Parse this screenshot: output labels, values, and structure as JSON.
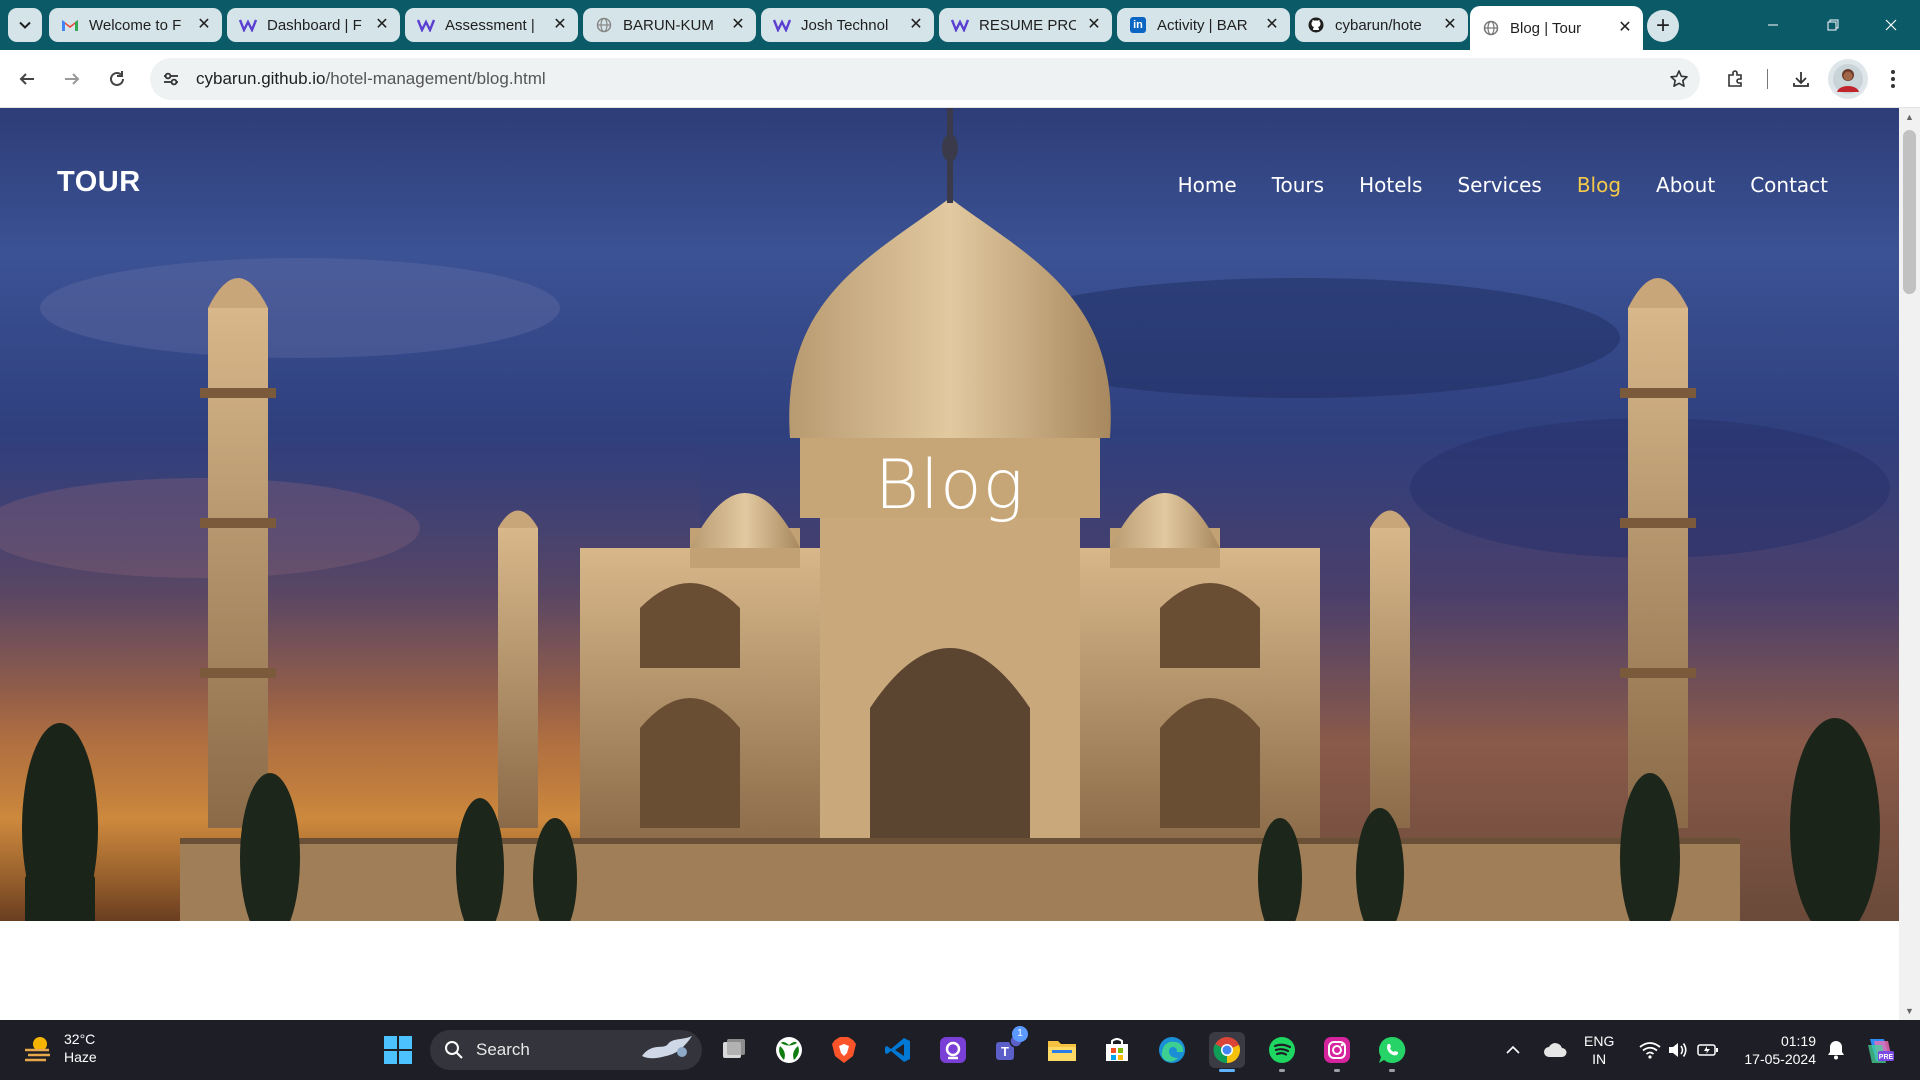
{
  "browser": {
    "tabs": [
      {
        "title": "Welcome to F",
        "favicon": "gmail-icon",
        "active": false
      },
      {
        "title": "Dashboard | F",
        "favicon": "wellfound-icon",
        "active": false
      },
      {
        "title": "Assessment |",
        "favicon": "wellfound-icon",
        "active": false
      },
      {
        "title": "BARUN-KUM",
        "favicon": "globe-icon",
        "active": false
      },
      {
        "title": "Josh Technol",
        "favicon": "wellfound-icon",
        "active": false
      },
      {
        "title": "RESUME PRO",
        "favicon": "wellfound-icon",
        "active": false
      },
      {
        "title": "Activity | BAR",
        "favicon": "linkedin-icon",
        "active": false
      },
      {
        "title": "cybarun/hote",
        "favicon": "github-icon",
        "active": false
      },
      {
        "title": "Blog | Tour",
        "favicon": "globe-icon",
        "active": true
      }
    ],
    "url_host": "cybarun.github.io",
    "url_path": "/hotel-management/blog.html",
    "colors": {
      "frame": "#0b5a68",
      "tab_inactive": "#d5e4e8"
    }
  },
  "site": {
    "brand": "TOUR",
    "menu": [
      {
        "label": "Home",
        "active": false
      },
      {
        "label": "Tours",
        "active": false
      },
      {
        "label": "Hotels",
        "active": false
      },
      {
        "label": "Services",
        "active": false
      },
      {
        "label": "Blog",
        "active": true
      },
      {
        "label": "About",
        "active": false
      },
      {
        "label": "Contact",
        "active": false
      }
    ],
    "hero_title": "Blog",
    "colors": {
      "active_link": "#f7c948"
    }
  },
  "taskbar": {
    "weather_temp": "32°C",
    "weather_desc": "Haze",
    "search_label": "Search",
    "apps": [
      {
        "name": "task-view-icon"
      },
      {
        "name": "xbox-icon"
      },
      {
        "name": "brave-icon"
      },
      {
        "name": "vscode-icon"
      },
      {
        "name": "app-icon"
      },
      {
        "name": "teams-icon",
        "badge": "1"
      },
      {
        "name": "file-explorer-icon"
      },
      {
        "name": "microsoft-store-icon"
      },
      {
        "name": "edge-icon"
      },
      {
        "name": "chrome-icon"
      },
      {
        "name": "spotify-icon"
      },
      {
        "name": "instagram-icon"
      },
      {
        "name": "whatsapp-icon"
      }
    ],
    "lang_top": "ENG",
    "lang_bottom": "IN",
    "time": "01:19",
    "date": "17-05-2024"
  }
}
